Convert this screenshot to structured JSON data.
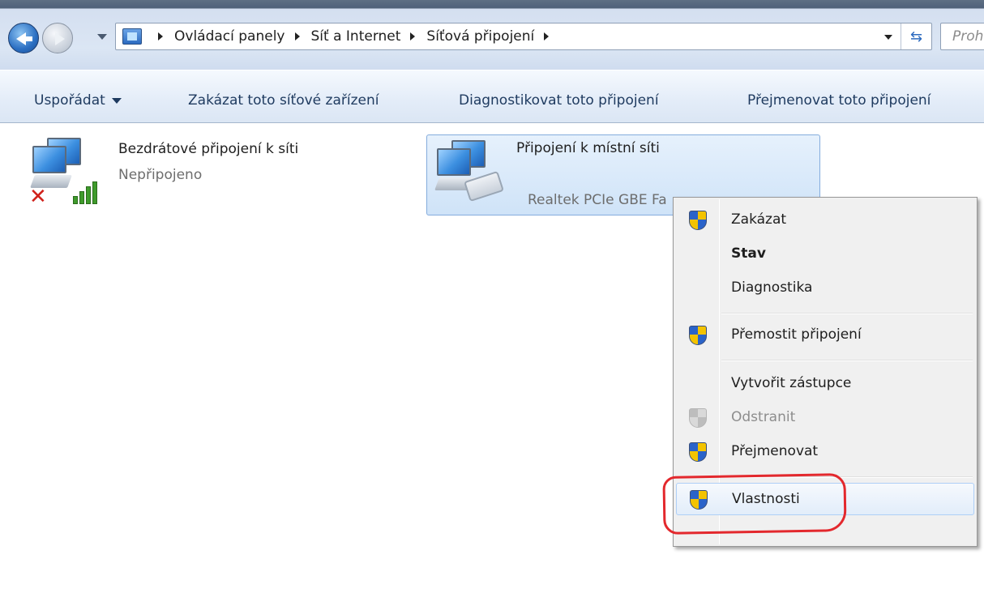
{
  "address": {
    "breadcrumbs": [
      "Ovládací panely",
      "Síť a Internet",
      "Síťová připojení"
    ],
    "search_placeholder": "Prohledat Síťová připojení"
  },
  "toolbar": {
    "organize": "Uspořádat",
    "disable_device": "Zakázat toto síťové zařízení",
    "diagnose": "Diagnostikovat toto připojení",
    "rename": "Přejmenovat toto připojení"
  },
  "connections": [
    {
      "name": "Bezdrátové připojení k síti",
      "status": "Nepřipojeno",
      "icon": "wireless-network-icon"
    },
    {
      "name": "Připojení k místní síti",
      "status": "Realtek PCIe GBE Fa",
      "icon": "lan-network-icon"
    }
  ],
  "context_menu": {
    "items": [
      {
        "label": "Zakázat",
        "shield": true
      },
      {
        "label": "Stav",
        "bold": true
      },
      {
        "label": "Diagnostika"
      },
      {
        "label": "Přemostit připojení",
        "shield": true
      },
      {
        "label": "Vytvořit zástupce"
      },
      {
        "label": "Odstranit",
        "shield": true,
        "disabled": true
      },
      {
        "label": "Přejmenovat",
        "shield": true
      },
      {
        "label": "Vlastnosti",
        "shield": true,
        "highlighted": true
      }
    ]
  },
  "colors": {
    "highlight_annotation": "#e3282d",
    "link_text": "#1e3a5f"
  }
}
